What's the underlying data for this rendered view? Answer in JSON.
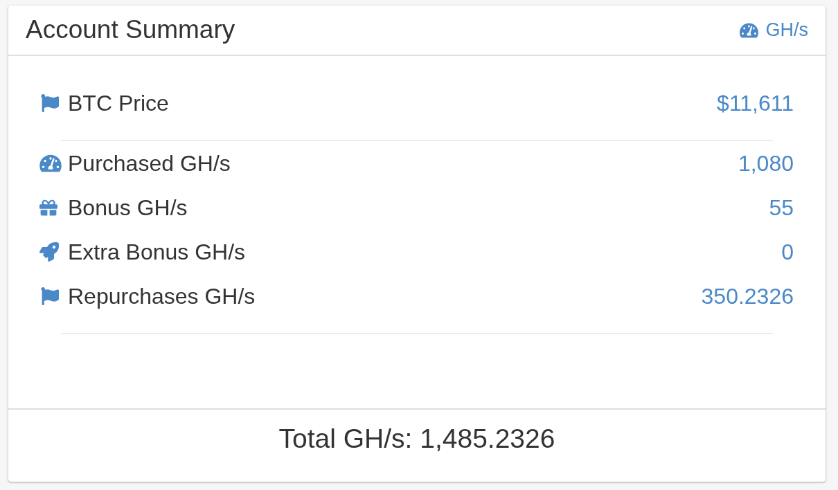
{
  "panel": {
    "title": "Account Summary",
    "header_link": "GH/s"
  },
  "sections": [
    {
      "rows": [
        {
          "label": "BTC Price",
          "value": "$11,611"
        }
      ]
    },
    {
      "rows": [
        {
          "label": "Purchased GH/s",
          "value": "1,080"
        },
        {
          "label": "Bonus GH/s",
          "value": "55"
        },
        {
          "label": "Extra Bonus GH/s",
          "value": "0"
        },
        {
          "label": "Repurchases GH/s",
          "value": "350.2326"
        }
      ]
    }
  ],
  "footer": {
    "total": "Total GH/s: 1,485.2326"
  }
}
